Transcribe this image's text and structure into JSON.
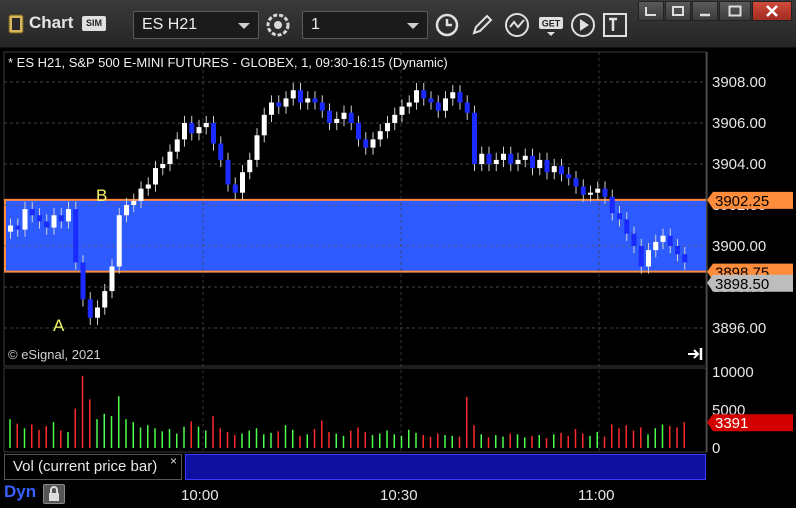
{
  "window": {
    "title": "Chart",
    "mode_badge": "SIM",
    "symbol_value": "ES H21",
    "interval_value": "1"
  },
  "icons": [
    "chart-app-icon",
    "sim-badge",
    "settings-gear-icon",
    "clock-icon",
    "pencil-draw-icon",
    "study-wave-icon",
    "get-menu-icon",
    "play-replay-icon",
    "text-tool-icon",
    "restore-window-icon",
    "tile-window-icon",
    "maximize-window-icon",
    "close-window-icon",
    "jump-to-end-icon",
    "link-lock-icon"
  ],
  "toolbar": {
    "get_label": "GET"
  },
  "chart": {
    "header": "* ES H21, S&P 500 E-MINI FUTURES - GLOBEX, 1, 09:30-16:15 (Dynamic)",
    "copyright": "© eSignal, 2021",
    "annotation_a": "A",
    "annotation_b": "B",
    "price_labels": [
      "3908.00",
      "3906.00",
      "3904.00",
      "3900.00",
      "3898.00",
      "3896.00"
    ],
    "overlapped_label": "3902.00",
    "level_high": "3902.25",
    "level_low": "3898.75",
    "last_price": "3898.50",
    "volume_labels": [
      "10000",
      "5000",
      "0"
    ],
    "volume_value": "3391",
    "time_labels": [
      "10:00",
      "10:30",
      "11:00"
    ],
    "colors": {
      "zone": "#2e5bff",
      "zone_border": "#ff8c3a",
      "up_bar": "#ffffff",
      "down_bar": "#1b2bff",
      "vol_up": "#4cff4c",
      "vol_down": "#ff2a2a",
      "volume_tag": "#d40000",
      "last_tag": "#bdbdbd"
    }
  },
  "study_panel": {
    "label": "Vol (current price bar)",
    "close": "×"
  },
  "footer": {
    "dyn_label": "Dyn"
  },
  "chart_data": {
    "type": "candlestick",
    "title": "* ES H21, S&P 500 E-MINI FUTURES - GLOBEX, 1, 09:30-16:15 (Dynamic)",
    "x_ticks": [
      "10:00",
      "10:30",
      "11:00"
    ],
    "ylim": [
      3895.0,
      3909.2
    ],
    "price_ticks": [
      3896,
      3898,
      3900,
      3902,
      3904,
      3906,
      3908
    ],
    "zone": {
      "high": 3902.25,
      "low": 3898.75
    },
    "last_price": 3898.5,
    "volume_ticks": [
      0,
      5000,
      10000
    ],
    "volume_current": 3391,
    "closes": [
      3901.0,
      3900.8,
      3901.8,
      3901.5,
      3901.2,
      3900.9,
      3901.5,
      3901.2,
      3901.8,
      3899.2,
      3897.4,
      3896.5,
      3897.0,
      3897.8,
      3899.0,
      3901.5,
      3902.0,
      3902.2,
      3902.8,
      3903.0,
      3903.8,
      3904.0,
      3904.6,
      3905.2,
      3906.0,
      3905.5,
      3905.8,
      3906.0,
      3905.0,
      3904.2,
      3903.0,
      3902.6,
      3903.6,
      3904.2,
      3905.4,
      3906.4,
      3907.0,
      3906.8,
      3907.2,
      3907.6,
      3907.0,
      3907.2,
      3907.0,
      3906.6,
      3906.0,
      3906.2,
      3906.5,
      3906.0,
      3905.2,
      3904.8,
      3905.2,
      3905.6,
      3906.0,
      3906.4,
      3906.8,
      3907.0,
      3907.6,
      3907.2,
      3907.0,
      3906.6,
      3907.2,
      3907.5,
      3907.0,
      3906.5,
      3904.0,
      3904.5,
      3904.0,
      3904.2,
      3904.5,
      3904.0,
      3904.2,
      3904.4,
      3903.8,
      3904.2,
      3903.6,
      3903.9,
      3903.5,
      3903.3,
      3902.9,
      3902.5,
      3902.6,
      3902.8,
      3902.4,
      3901.6,
      3901.3,
      3900.6,
      3900.0,
      3899.0,
      3899.8,
      3900.2,
      3900.5,
      3900.0,
      3899.6,
      3899.2
    ],
    "volumes": [
      3800,
      3200,
      2600,
      3100,
      2400,
      2900,
      3400,
      2300,
      2100,
      5200,
      9500,
      6400,
      3800,
      4500,
      4200,
      6800,
      3800,
      3400,
      2700,
      3000,
      2600,
      2200,
      2500,
      1900,
      2800,
      3500,
      2800,
      2300,
      4200,
      2600,
      2100,
      1700,
      1900,
      2300,
      2600,
      1800,
      2000,
      2200,
      3000,
      2400,
      1600,
      1800,
      2500,
      3600,
      2100,
      1900,
      1600,
      2300,
      2700,
      2100,
      1700,
      1900,
      2300,
      1800,
      1600,
      2400,
      2000,
      1700,
      1500,
      1900,
      1700,
      1600,
      1500,
      6700,
      3000,
      1800,
      1400,
      1700,
      1500,
      1900,
      1800,
      1400,
      1600,
      1700,
      1300,
      1800,
      2000,
      1600,
      2500,
      1900,
      1600,
      2100,
      1500,
      3100,
      2600,
      3000,
      2300,
      2700,
      1800,
      2600,
      3100,
      2900,
      2700,
      3391
    ]
  }
}
